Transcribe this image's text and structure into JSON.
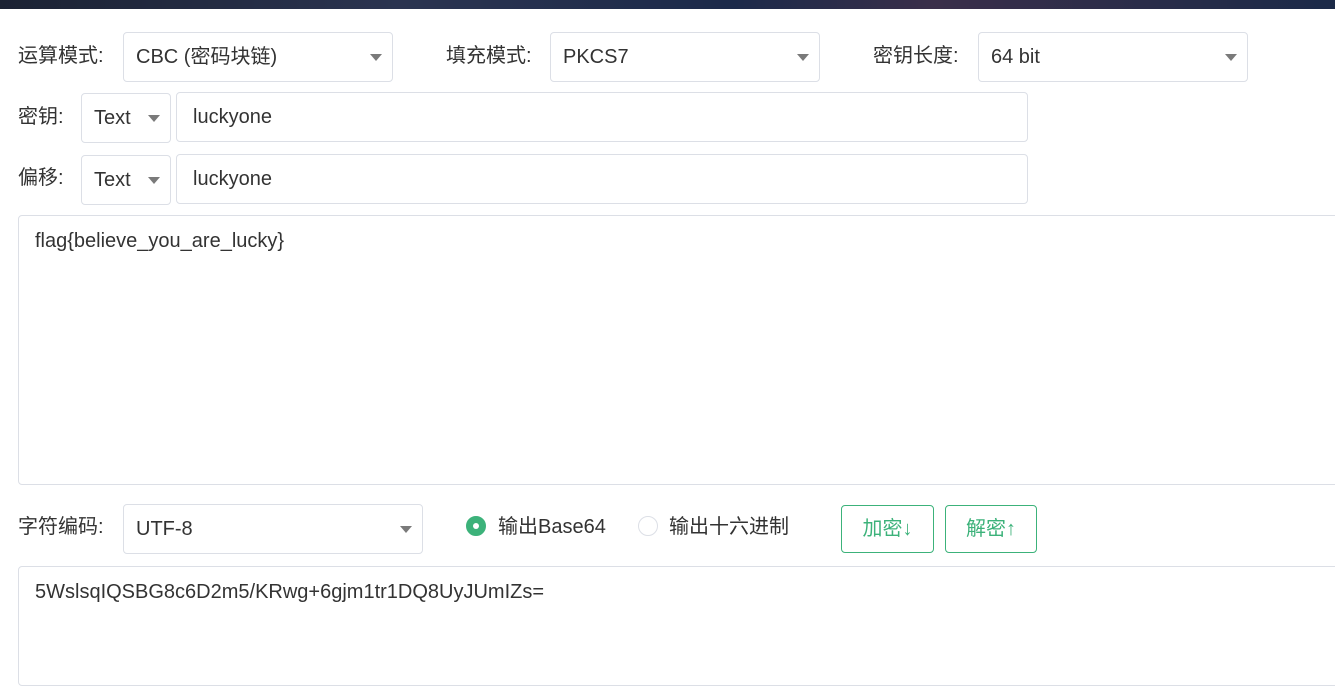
{
  "colors": {
    "accent": "#3cb27a",
    "border": "#dcdfe6",
    "text": "#333333"
  },
  "mode": {
    "label": "运算模式:",
    "value": "CBC (密码块链)"
  },
  "padding": {
    "label": "填充模式:",
    "value": "PKCS7"
  },
  "keylen": {
    "label": "密钥长度:",
    "value": "64 bit"
  },
  "key": {
    "label": "密钥:",
    "format": "Text",
    "value": "luckyone"
  },
  "iv": {
    "label": "偏移:",
    "format": "Text",
    "value": "luckyone"
  },
  "plaintext": "flag{believe_you_are_lucky}",
  "charset": {
    "label": "字符编码:",
    "value": "UTF-8"
  },
  "output": {
    "base64_label": "输出Base64",
    "hex_label": "输出十六进制",
    "base64_selected": true
  },
  "buttons": {
    "encrypt": "加密↓",
    "decrypt": "解密↑"
  },
  "ciphertext": "5WslsqIQSBG8c6D2m5/KRwg+6gjm1tr1DQ8UyJUmIZs="
}
